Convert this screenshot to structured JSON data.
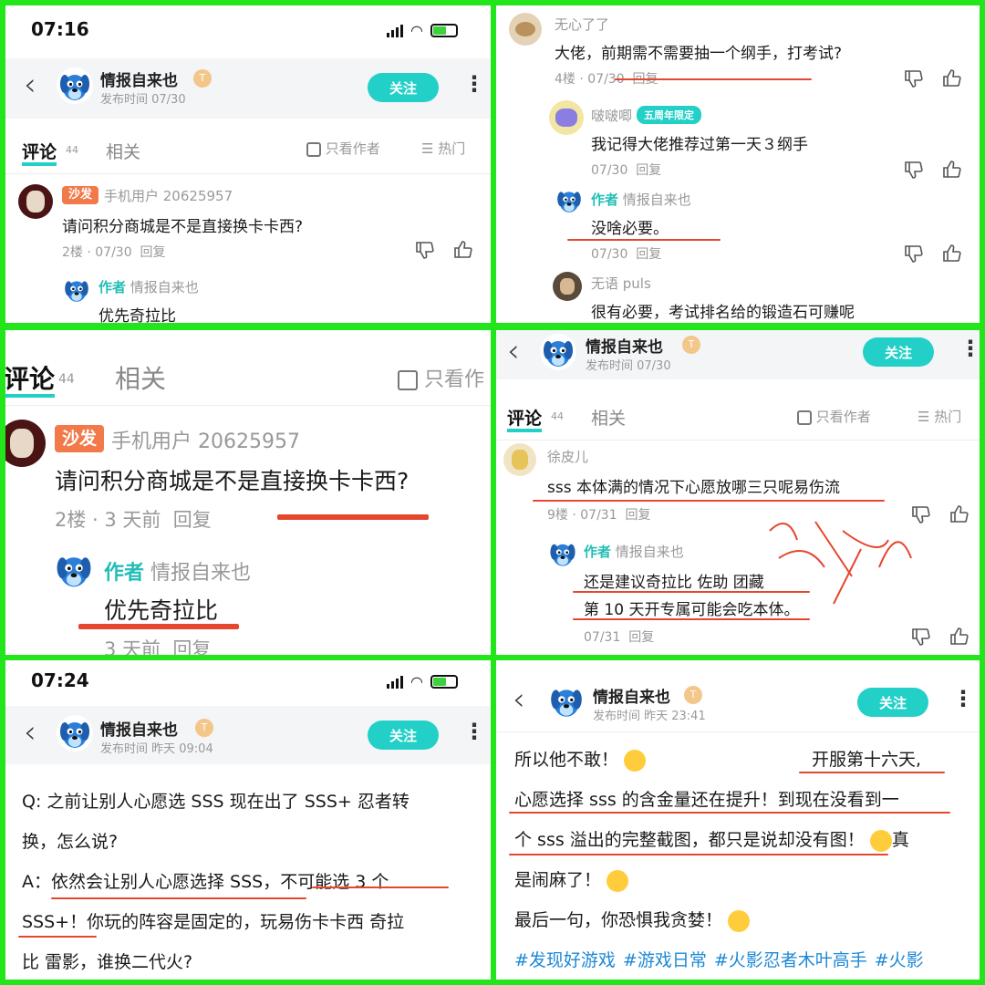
{
  "p1": {
    "time": "07:16",
    "author": "情报自来也",
    "pubtime": "发布时间 07/30",
    "follow": "关注",
    "tab_comment": "评论",
    "tab_count": "44",
    "tab_related": "相关",
    "only_author": "只看作者",
    "hot": "热门",
    "sofa": "沙发",
    "user": "手机用户 20625957",
    "comment": "请问积分商城是不是直接换卡卡西?",
    "meta": "2楼 · 07/30",
    "reply": "回复",
    "author_tag": "作者",
    "reply_author": "情报自来也",
    "reply_text": "优先奇拉比"
  },
  "p2": {
    "c1_user": "无心了了",
    "c1_text": "大佬，前期需不需要抽一个纲手，打考试?",
    "c1_meta": "4楼 · 07/30",
    "reply": "回复",
    "c2_user": "啵啵唧",
    "c2_badge": "五周年限定",
    "c2_text": "我记得大佬推荐过第一天３纲手",
    "c2_meta": "07/30",
    "c3_tag": "作者",
    "c3_user": "情报自来也",
    "c3_text": "没啥必要。",
    "c3_meta": "07/30",
    "c4_user": "无语 puls",
    "c4_text": "很有必要，考试排名给的锻造石可赚呢"
  },
  "p3": {
    "tab_comment": "评论",
    "tab_count": "44",
    "tab_related": "相关",
    "only_author": "只看作",
    "sofa": "沙发",
    "user": "手机用户 20625957",
    "comment": "请问积分商城是不是直接换卡卡西?",
    "meta": "2楼 · 3 天前",
    "reply": "回复",
    "author_tag": "作者",
    "reply_author": "情报自来也",
    "reply_text": "优先奇拉比",
    "reply_meta": "3 天前"
  },
  "p4": {
    "author": "情报自来也",
    "pubtime": "发布时间 07/30",
    "follow": "关注",
    "tab_comment": "评论",
    "tab_count": "44",
    "tab_related": "相关",
    "only_author": "只看作者",
    "hot": "热门",
    "user": "徐皮儿",
    "comment": "sss 本体满的情况下心愿放哪三只呢易伤流",
    "meta": "9楼 · 07/31",
    "reply": "回复",
    "author_tag": "作者",
    "reply_author": "情报自来也",
    "reply_line1": "还是建议奇拉比 佐助 团藏",
    "reply_line2": "第 10 天开专属可能会吃本体。",
    "reply_meta": "07/31"
  },
  "p5": {
    "time": "07:24",
    "author": "情报自来也",
    "pubtime": "发布时间 昨天 09:04",
    "follow": "关注",
    "q_line1": "Q: 之前让别人心愿选 SSS 现在出了 SSS+ 忍者转",
    "q_line2": "换，怎么说?",
    "a_line1": "A：依然会让别人心愿选择 SSS，不可能选 3 个",
    "a_line2": "SSS+！你玩的阵容是固定的，玩易伤卡卡西 奇拉",
    "a_line3": "比 雷影，谁换二代火?"
  },
  "p6": {
    "author": "情报自来也",
    "pubtime": "发布时间 昨天 23:41",
    "follow": "关注",
    "l1a": "所以他不敢！",
    "l1b": "开服第十六天,",
    "l2": "心愿选择 sss 的含金量还在提升！到现在没看到一",
    "l3": "个 sss 溢出的完整截图，都只是说却没有图！",
    "l3b": "真",
    "l4": "是闹麻了！",
    "l5": "最后一句，你恐惧我贪婪！",
    "tags": [
      "#发现好游戏",
      "#游戏日常",
      "#火影忍者木叶高手",
      "#火影"
    ]
  },
  "colors": {
    "accent": "#22d0c8",
    "frame": "#22e51c",
    "underline": "#e4472e",
    "sofa": "#f27a4a"
  }
}
